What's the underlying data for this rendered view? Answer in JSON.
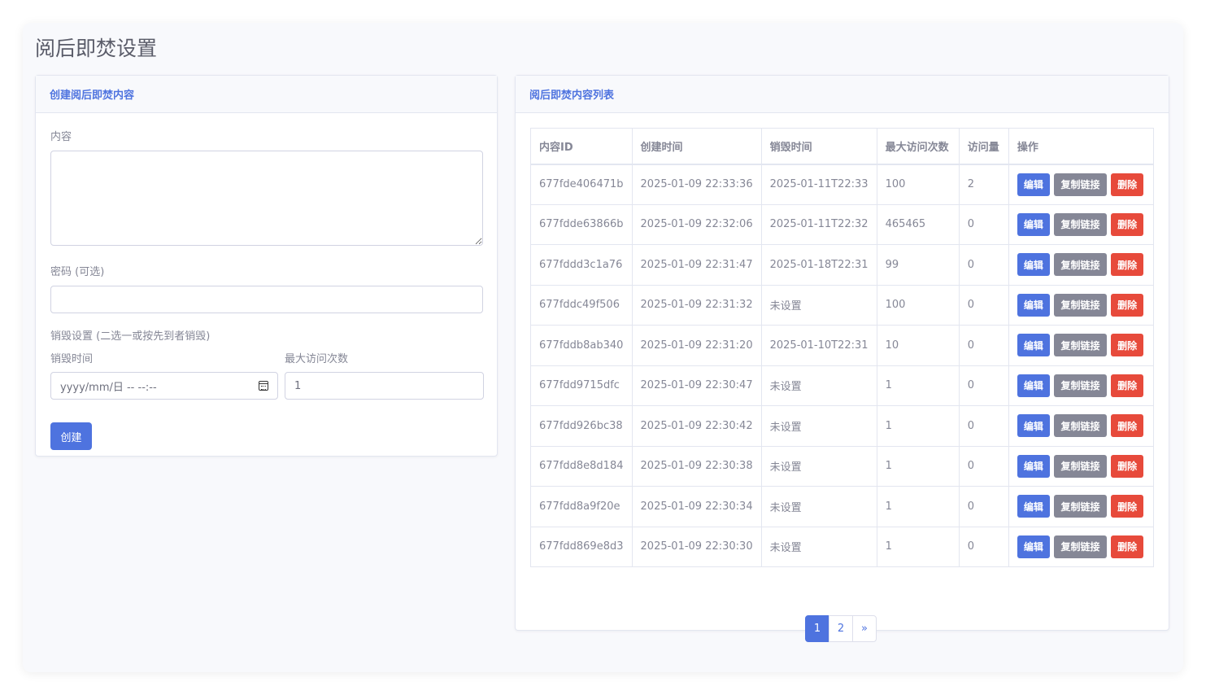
{
  "page": {
    "title": "阅后即焚设置"
  },
  "create_form": {
    "header": "创建阅后即焚内容",
    "content_label": "内容",
    "content_value": "",
    "password_label": "密码 (可选)",
    "password_value": "",
    "destroy_settings_label": "销毁设置 (二选一或按先到者销毁)",
    "destroy_time_label": "销毁时间",
    "destroy_time_placeholder": "yyyy/mm/日 -- --:--",
    "max_visits_label": "最大访问次数",
    "max_visits_value": "1",
    "create_button": "创建"
  },
  "list": {
    "header": "阅后即焚内容列表",
    "columns": [
      "内容ID",
      "创建时间",
      "销毁时间",
      "最大访问次数",
      "访问量",
      "操作"
    ],
    "rows": [
      {
        "id": "677fde406471b",
        "created": "2025-01-09 22:33:36",
        "destroy": "2025-01-11T22:33",
        "max": "100",
        "visits": "2"
      },
      {
        "id": "677fdde63866b",
        "created": "2025-01-09 22:32:06",
        "destroy": "2025-01-11T22:32",
        "max": "465465",
        "visits": "0"
      },
      {
        "id": "677fddd3c1a76",
        "created": "2025-01-09 22:31:47",
        "destroy": "2025-01-18T22:31",
        "max": "99",
        "visits": "0"
      },
      {
        "id": "677fddc49f506",
        "created": "2025-01-09 22:31:32",
        "destroy": "未设置",
        "max": "100",
        "visits": "0"
      },
      {
        "id": "677fddb8ab340",
        "created": "2025-01-09 22:31:20",
        "destroy": "2025-01-10T22:31",
        "max": "10",
        "visits": "0"
      },
      {
        "id": "677fdd9715dfc",
        "created": "2025-01-09 22:30:47",
        "destroy": "未设置",
        "max": "1",
        "visits": "0"
      },
      {
        "id": "677fdd926bc38",
        "created": "2025-01-09 22:30:42",
        "destroy": "未设置",
        "max": "1",
        "visits": "0"
      },
      {
        "id": "677fdd8e8d184",
        "created": "2025-01-09 22:30:38",
        "destroy": "未设置",
        "max": "1",
        "visits": "0"
      },
      {
        "id": "677fdd8a9f20e",
        "created": "2025-01-09 22:30:34",
        "destroy": "未设置",
        "max": "1",
        "visits": "0"
      },
      {
        "id": "677fdd869e8d3",
        "created": "2025-01-09 22:30:30",
        "destroy": "未设置",
        "max": "1",
        "visits": "0"
      }
    ],
    "actions": {
      "edit": "编辑",
      "copy": "复制链接",
      "delete": "删除"
    },
    "pagination": {
      "pages": [
        "1",
        "2"
      ],
      "next": "»",
      "current": "1"
    }
  },
  "colors": {
    "primary": "#4e73df",
    "secondary": "#858796",
    "danger": "#e74a3b",
    "text": "#858796",
    "bg": "#f8f9fc"
  }
}
